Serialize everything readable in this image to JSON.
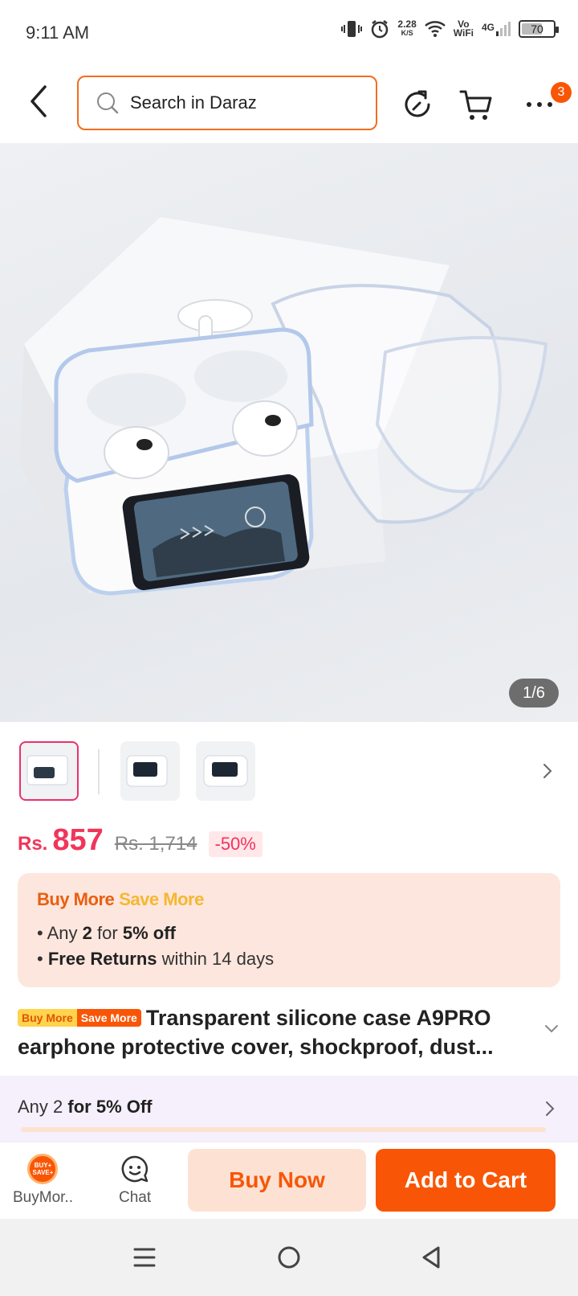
{
  "status_bar": {
    "time": "9:11 AM",
    "net_speed": "2.28",
    "net_unit": "K/S",
    "vowifi_top": "Vo",
    "vowifi_bottom": "WiFi",
    "network": "4G",
    "battery": "70",
    "battery_level_percent": 70
  },
  "header": {
    "search_placeholder": "Search in Daraz",
    "more_badge": "3"
  },
  "gallery": {
    "page_indicator": "1/6",
    "thumbnails": [
      {
        "state": "active"
      },
      {
        "state": "inactive"
      },
      {
        "state": "inactive"
      }
    ]
  },
  "price": {
    "currency": "Rs.",
    "current": "857",
    "original": "Rs. 1,714",
    "discount": "-50%"
  },
  "promo": {
    "title_part1": "Buy More",
    "title_part2": "Save More",
    "line1_pre": "Any",
    "line1_qty": "2",
    "line1_mid": "for",
    "line1_off": "5% off",
    "line2_bold": "Free Returns",
    "line2_rest": "within 14 days"
  },
  "product": {
    "tag1": "Buy More",
    "tag2": "Save More",
    "title": "Transparent silicone case A9PRO earphone protective cover, shockproof, dust..."
  },
  "deal_bar": {
    "pre": "Any 2",
    "bold": "for 5% Off"
  },
  "action_bar": {
    "buymore_label": "BuyMor..",
    "buymore_badge_top": "BUY+",
    "buymore_badge_bottom": "SAVE+",
    "chat_label": "Chat",
    "buy_now": "Buy Now",
    "add_to_cart": "Add to Cart"
  },
  "colors": {
    "accent": "#f85606",
    "price": "#f0355b",
    "promo_bg": "#fde6dd"
  }
}
